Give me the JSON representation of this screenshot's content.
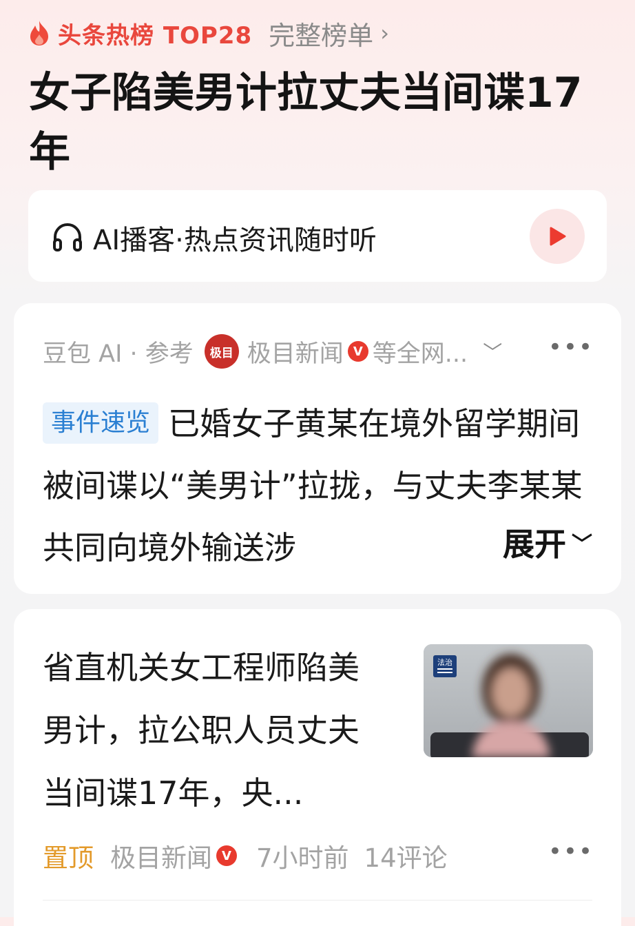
{
  "header": {
    "hot_list_label": "头条热榜 TOP28",
    "full_list_label": "完整榜单",
    "headline": "女子陷美男计拉丈夫当间谍17年"
  },
  "podcast": {
    "title": "AI播客·热点资讯随时听",
    "icon": "headphones-icon",
    "play_icon": "play-icon"
  },
  "summary_card": {
    "source_prefix": "豆包 AI · 参考",
    "source_logo_text": "极目",
    "source_name": "极目新闻",
    "verified_mark": "V",
    "source_suffix": "等全网...",
    "tag": "事件速览",
    "text": "已婚女子黄某在境外留学期间被间谍以“美男计”拉拢，与丈夫李某某共同向境外输送涉",
    "expand_label": "展开"
  },
  "article": {
    "title": "省直机关女工程师陷美男计，拉公职人员丈夫当间谍17年，央...",
    "thumb_badge": "法治",
    "pin_label": "置顶",
    "source": "极目新闻",
    "verified_mark": "V",
    "time": "7小时前",
    "comments": "14评论"
  },
  "colors": {
    "brand_red": "#e9473d",
    "tag_blue": "#2a7fd2",
    "pin_orange": "#e39a2a"
  }
}
